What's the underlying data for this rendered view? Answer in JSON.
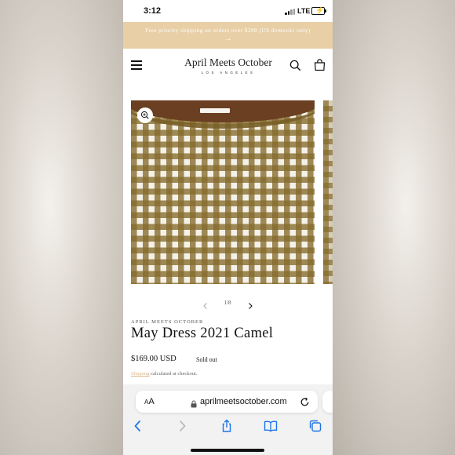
{
  "status": {
    "time": "3:12",
    "network": "LTE"
  },
  "announcement": {
    "text": "Free priority shipping on orders over $200 (US domestic only)",
    "arrow": "→"
  },
  "header": {
    "brand": "April Meets October",
    "tagline": "LOS ANGELES"
  },
  "gallery": {
    "counter": "1/8"
  },
  "product": {
    "vendor": "APRIL MEETS OCTOBER",
    "title": "May Dress 2021 Camel",
    "price": "$169.00 USD",
    "badge": "Sold out",
    "shipping_link": "Shipping",
    "shipping_text": " calculated at checkout."
  },
  "browser": {
    "aa_small": "A",
    "aa_large": "A",
    "url": "aprilmeetsoctober.com"
  },
  "colors": {
    "announcement_bg": "#e8cfa6",
    "gingham": "#856b2c",
    "accent": "#1a73e8"
  }
}
